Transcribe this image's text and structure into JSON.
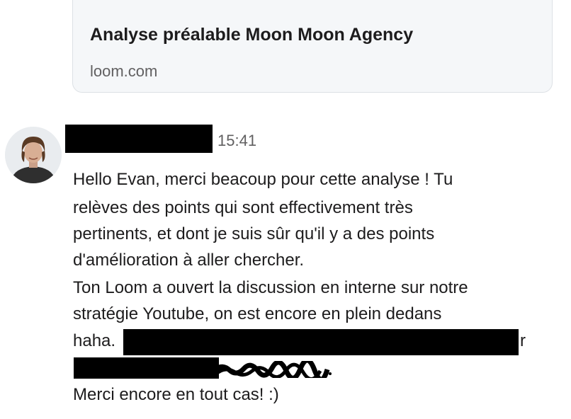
{
  "link_preview": {
    "title": "Analyse préalable Moon Moon Agency",
    "domain": "loom.com"
  },
  "message": {
    "timestamp": "15:41",
    "lines": [
      "Hello Evan, merci beacoup pour cette analyse ! Tu",
      "relèves des points qui sont effectivement très",
      "pertinents, et dont je suis sûr qu'il y a des points",
      "d'amélioration à aller chercher.",
      "Ton Loom a ouvert la discussion en interne sur notre",
      "stratégie Youtube, on est encore en plein dedans",
      "haha.",
      "r",
      "Merci encore en tout cas! :)"
    ]
  },
  "colors": {
    "text": "#1d1c1d",
    "muted": "#616061",
    "card_bg": "#f5f7f9",
    "card_border": "#dde1e5",
    "redaction": "#000000"
  },
  "icons": [
    "user-avatar"
  ]
}
